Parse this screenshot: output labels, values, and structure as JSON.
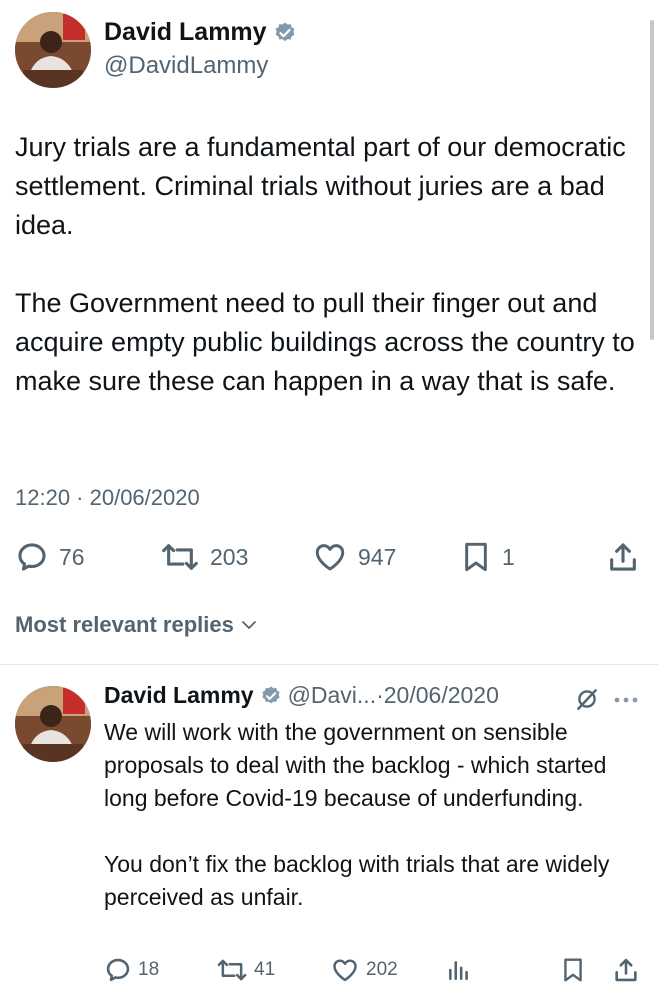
{
  "main_tweet": {
    "author_name": "David Lammy",
    "author_handle": "@DavidLammy",
    "paragraphs": [
      "Jury trials are a fundamental part of our democratic settlement. Criminal trials without juries are a bad idea.",
      "The Government need to pull their finger out and acquire empty public buildings across the country to make sure these can happen in a way that is safe."
    ],
    "timestamp": "12:20 · 20/06/2020",
    "metrics": {
      "replies": "76",
      "reposts": "203",
      "likes": "947",
      "bookmarks": "1"
    }
  },
  "replies_sort_label": "Most relevant replies",
  "reply": {
    "author_name": "David Lammy",
    "author_handle": "@Davi...",
    "separator": " · ",
    "date": "20/06/2020",
    "paragraphs": [
      "We will work with the government on sensible proposals to deal with the backlog - which started long before Covid-19 because of underfunding.",
      "You don’t fix the backlog with trials that are widely perceived as unfair."
    ],
    "metrics": {
      "replies": "18",
      "reposts": "41",
      "likes": "202"
    }
  },
  "colors": {
    "verified_badge": "#829aab",
    "secondary_text": "#536471",
    "primary_text": "#0f1419"
  },
  "icons": [
    "verified-badge-icon",
    "reply-icon",
    "repost-icon",
    "like-icon",
    "bookmark-icon",
    "share-icon",
    "views-icon",
    "grok-icon",
    "more-icon",
    "chevron-down-icon"
  ]
}
